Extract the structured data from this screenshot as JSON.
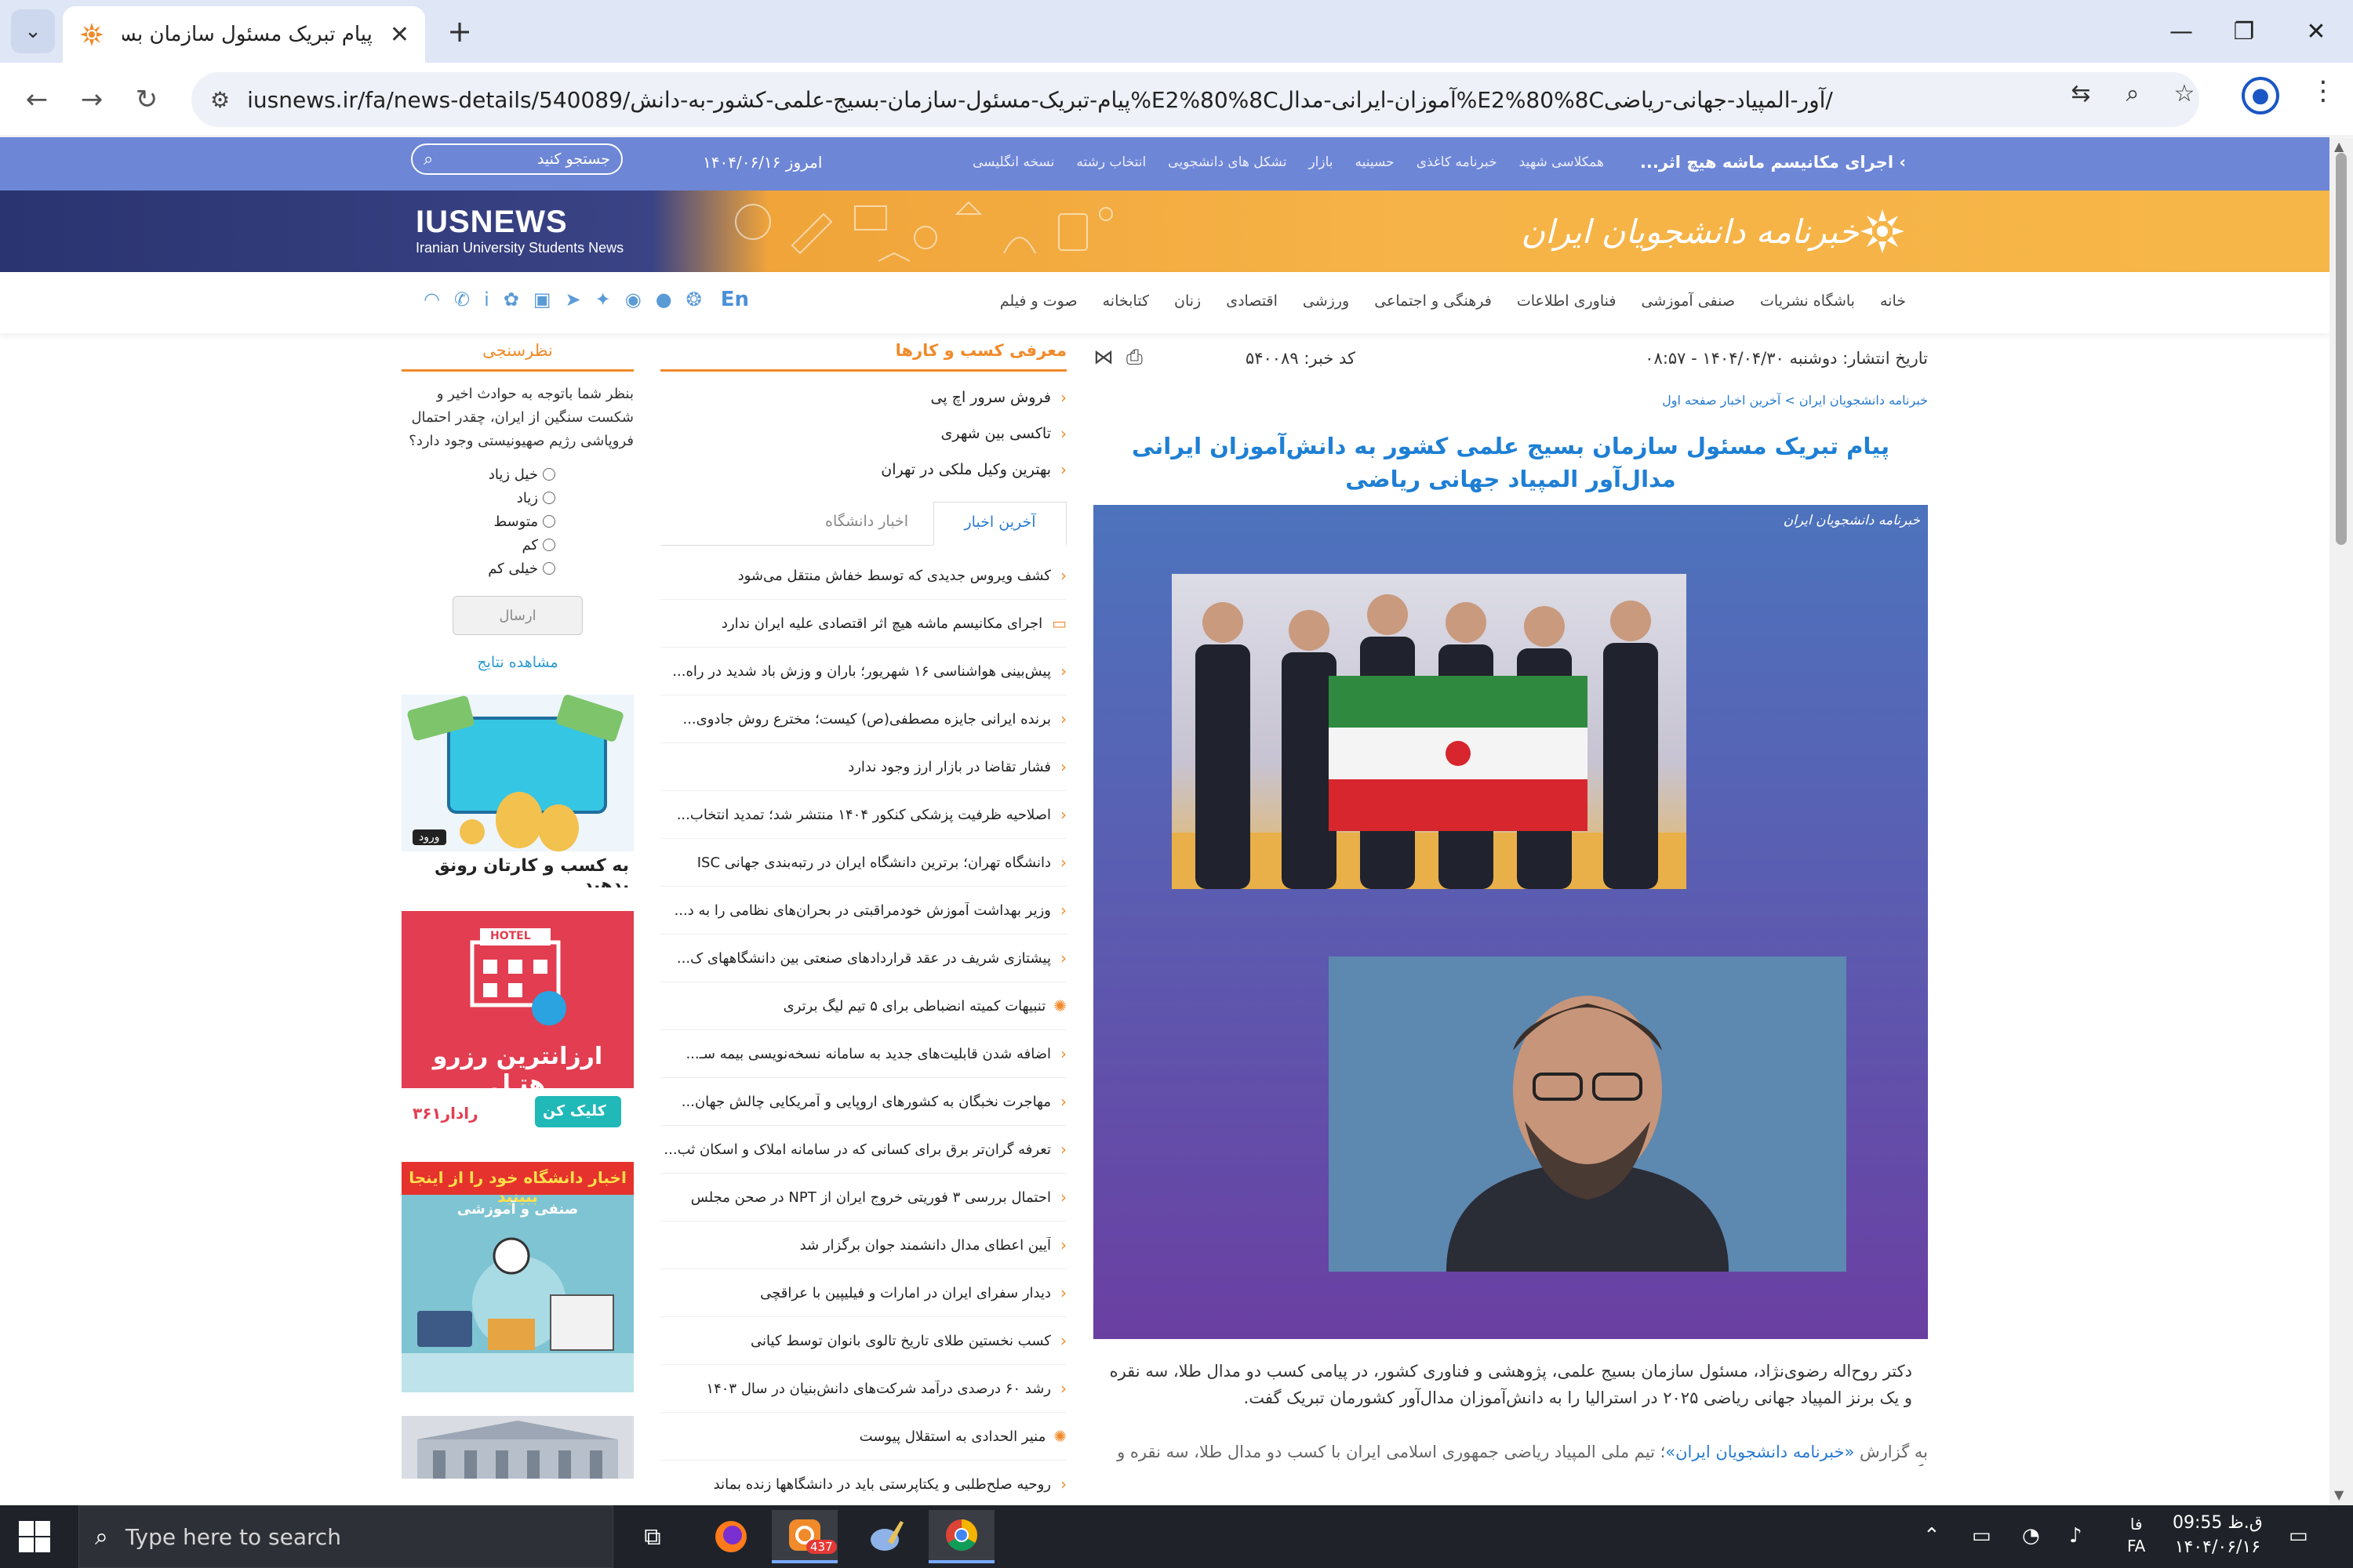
{
  "browser": {
    "tab_title": "پیام تبریک مسئول سازمان بسیج ع",
    "url": "iusnews.ir/fa/news-details/540089/پیام-تبریک-مسئول-سازمان-بسیج-علمی-کشور-به-دانش%E2%80%8Cآموزان-ایرانی-مدال%E2%80%8Cآور-المپیاد-جهانی-ریاضی/"
  },
  "site": {
    "ticker": "اجرای مکانیسم ماشه هیچ اثر...",
    "top_links": [
      "همکلاسی شهید",
      "خبرنامه کاغذی",
      "حسینیه",
      "بازار",
      "تشکل های دانشجویی",
      "انتخاب رشته",
      "نسخه انگلیسی"
    ],
    "today": "امروز ۱۴۰۴/۰۶/۱۶",
    "search_label": "جستجو کنید",
    "brand_en": "IUSNEWS",
    "brand_en_sub": "Iranian University Students News",
    "brand_fa": "خبرنامه دانشجویان ایران",
    "nav": [
      "خانه",
      "باشگاه نشریات",
      "صنفی آموزشی",
      "فناوری اطلاعات",
      "فرهنگی و اجتماعی",
      "ورزشی",
      "اقتصادی",
      "زنان",
      "کتابخانه",
      "صوت و فیلم"
    ],
    "lang_en": "En"
  },
  "article": {
    "published": "تاریخ انتشار: دوشنبه ۱۴۰۴/۰۴/۳۰ - ۰۸:۵۷",
    "code": "کد خبر: ۵۴۰۰۸۹",
    "breadcrumb": "خبرنامه دانشجویان ایران > آخرین اخبار صفحه اول",
    "title": "پیام تبریک مسئول سازمان بسیج علمی کشور به دانش‌آموزان ایرانی مدال‌آور المپیاد جهانی ریاضی",
    "watermark": "خبرنامه دانشجویان ایران",
    "lead": "دکتر روح‌اله رضوی‌نژاد، مسئول سازمان بسیج علمی، پژوهشی و فناوری کشور، در پیامی کسب دو مدال طلا، سه نقره و یک برنز المپیاد جهانی ریاضی ۲۰۲۵ در استرالیا را به دانش‌آموزان مدال‌آور کشورمان تبریک گفت.",
    "body_prefix": "به گزارش ",
    "body_link": "«خبرنامه دانشجویان ایران»",
    "body_rest": "؛ تیم ملی المپیاد ریاضی جمهوری اسلامی ایران با کسب دو مدال طلا، سه نقره و یک برنز"
  },
  "middle": {
    "business_title": "معرفی کسب و کارها",
    "business": [
      "فروش سرور اچ پی",
      "تاکسی بین شهری",
      "بهترین وکیل ملکی در تهران"
    ],
    "tab_latest": "آخرین اخبار",
    "tab_university": "اخبار دانشگاه",
    "news": [
      {
        "text": "کشف ویروس جدیدی که توسط خفاش منتقل می‌شود",
        "icon": "chevron"
      },
      {
        "text": "اجرای مکانیسم ماشه هیچ اثر اقتصادی علیه ایران ندارد",
        "icon": "video"
      },
      {
        "text": "پیش‌بینی هواشناسی ۱۶ شهریور؛ باران و وزش باد شدید در راه...",
        "icon": "chevron"
      },
      {
        "text": "برنده ایرانی جایزه مصطفی(ص) کیست؛ مخترع روش جادوی...",
        "icon": "chevron"
      },
      {
        "text": "فشار تقاضا در بازار ارز وجود ندارد",
        "icon": "chevron"
      },
      {
        "text": "اصلاحیه ظرفیت پزشکی کنکور ۱۴۰۴ منتشر شد؛ تمدید انتخاب...",
        "icon": "chevron"
      },
      {
        "text": "دانشگاه تهران؛ برترین دانشگاه ایران در رتبه‌بندی جهانی ISC",
        "icon": "chevron"
      },
      {
        "text": "وزیر بهداشت آموزش خودمراقبتی در بحران‌های نظامی را به د...",
        "icon": "chevron"
      },
      {
        "text": "پیشتازی شریف در عقد قراردادهای صنعتی بین دانشگاههای ک...",
        "icon": "chevron"
      },
      {
        "text": "تنبیهات کمیته انضباطی برای ۵ تیم لیگ برتری",
        "icon": "ball"
      },
      {
        "text": "اضافه شدن قابلیت‌های جدید به سامانه نسخه‌نویسی بیمه سـ...",
        "icon": "chevron"
      },
      {
        "text": "مهاجرت نخبگان به کشورهای اروپایی و آمریکایی چالش جهان...",
        "icon": "chevron"
      },
      {
        "text": "تعرفه گران‌تر برق برای کسانی که در سامانه املاک و اسکان ثب...",
        "icon": "chevron"
      },
      {
        "text": "احتمال بررسی ۳ فوریتی خروج ایران از NPT در صحن مجلس",
        "icon": "chevron"
      },
      {
        "text": "آیین اعطای مدال دانشمند جوان برگزار شد",
        "icon": "chevron"
      },
      {
        "text": "دیدار سفرای ایران در امارات و فیلیپین با عراقچی",
        "icon": "chevron"
      },
      {
        "text": "کسب نخستین طلای تاریخ تالوی بانوان توسط کیانی",
        "icon": "chevron"
      },
      {
        "text": "رشد ۶۰ درصدی درآمد شرکت‌های دانش‌بنیان در سال ۱۴۰۳",
        "icon": "chevron"
      },
      {
        "text": "منیر الحدادی به استقلال پیوست",
        "icon": "ball"
      },
      {
        "text": "روحیه صلح‌طلبی و یکتاپرستی باید در دانشگاهها زنده بماند",
        "icon": "chevron"
      }
    ]
  },
  "poll": {
    "title": "نظرسنجی",
    "question": "بنظر شما باتوجه به حوادث اخیر و شکست سنگین از ایران، چقدر احتمال فروپاشی رژیم صهیونیستی وجود دارد؟",
    "options": [
      "خیل زیاد",
      "زیاد",
      "متوسط",
      "کم",
      "خیلی کم"
    ],
    "submit": "ارسال",
    "results": "مشاهده نتایج"
  },
  "ads": {
    "ad1_enter": "ورود",
    "ad1_text": "به کسب و کارتان رونق بدهید",
    "ad2_hotel": "HOTEL",
    "ad2_text": "ارزانترین رزرو هتـل",
    "ad2_btn": "کلیک کن",
    "ad2_brand": "رادار۳۶۱",
    "ad3_title": "اخبار دانشگاه خود را از اینجا ببینید",
    "ad3_sub": "صنفی و آموزشی"
  },
  "taskbar": {
    "search_placeholder": "Type here to search",
    "badge": "437",
    "lang": "فا",
    "lang2": "FA",
    "time": "ق.ظ 09:55",
    "date": "۱۴۰۴/۰۶/۱۶"
  }
}
